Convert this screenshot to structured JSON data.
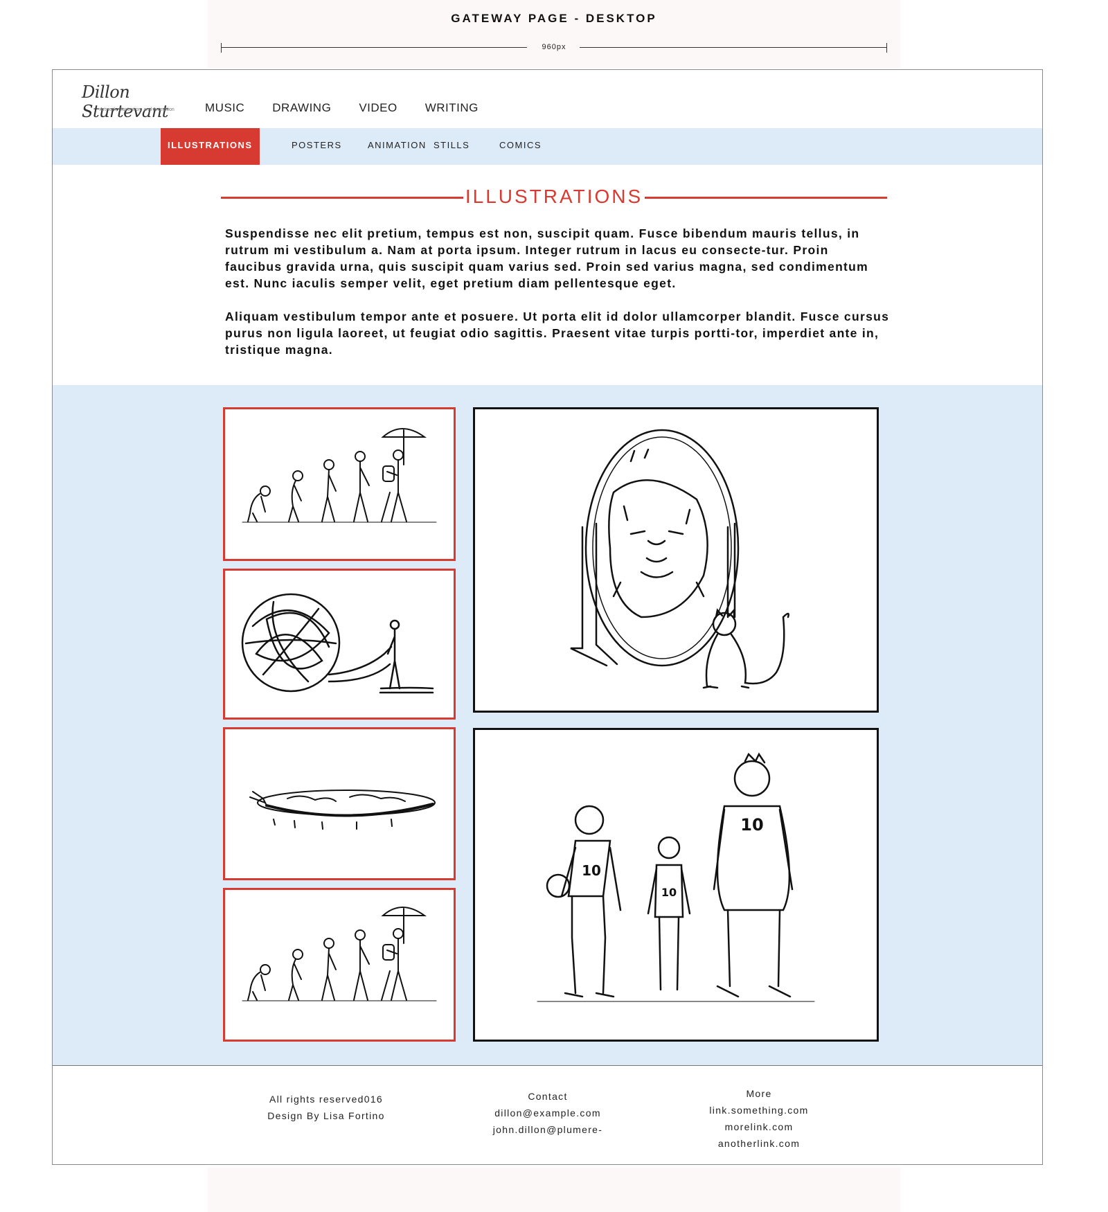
{
  "page_label": "GATEWAY PAGE - DESKTOP",
  "ruler_label": "960px",
  "logo": {
    "signature": "Dillon Sturtevant",
    "tagline": "Artwork, Illustration, and Animation"
  },
  "nav": [
    "MUSIC",
    "DRAWING",
    "VIDEO",
    "WRITING"
  ],
  "subnav": [
    "ILLUSTRATIONS",
    "POSTERS",
    "ANIMATION  STILLS",
    "COMICS"
  ],
  "subnav_active": "ILLUSTRATIONS",
  "section_title": "ILLUSTRATIONS",
  "paragraphs": [
    "Suspendisse nec elit pretium, tempus est non, suscipit quam. Fusce bibendum mauris tellus, in rutrum mi vestibulum a. Nam at porta ipsum. Integer rutrum in lacus eu consecte-tur. Proin faucibus gravida urna, quis suscipit quam varius sed. Proin sed varius magna, sed condimentum est. Nunc iaculis semper velit, eget pretium diam pellentesque eget.",
    "Aliquam vestibulum tempor ante et posuere. Ut porta elit id dolor ullamcorper blandit. Fusce cursus purus non ligula laoreet, ut feugiat odio sagittis. Praesent vitae turpis portti-tor, imperdiet ante in, tristique magna."
  ],
  "gallery": {
    "thumbnails": [
      "evolution-illustration",
      "tangled-ball-illustration",
      "flat-earth-illustration",
      "evolution-illustration"
    ],
    "featured": [
      "lion-mirror-cat-illustration",
      "basketball-players-illustration"
    ],
    "jersey_number": "10"
  },
  "footer": {
    "left": [
      "All rights reserved016",
      "Design By Lisa Fortino"
    ],
    "contact": [
      "Contact",
      "dillon@example.com",
      "john.dillon@plumere-"
    ],
    "more": [
      "More",
      "link.something.com",
      "morelink.com",
      "anotherlink.com"
    ]
  },
  "colors": {
    "accent": "#d73a31",
    "band": "#ddebf8",
    "ink": "#111111"
  }
}
